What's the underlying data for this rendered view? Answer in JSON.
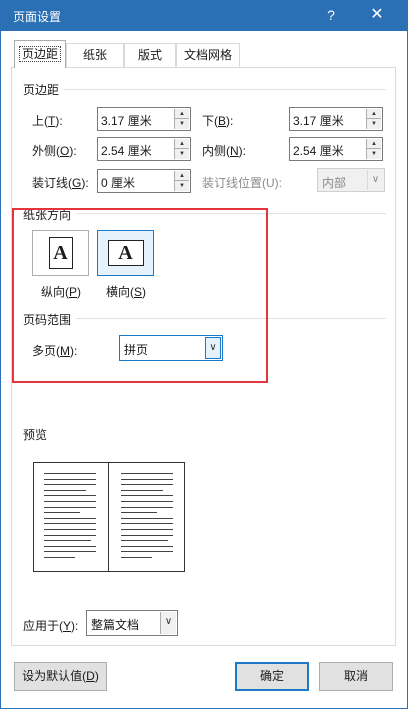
{
  "titlebar": {
    "title": "页面设置",
    "help": "?",
    "close": "✕"
  },
  "tabs": [
    "页边距",
    "纸张",
    "版式",
    "文档网格"
  ],
  "margins": {
    "group_label": "页边距",
    "top": {
      "label_pre": "上(",
      "key": "T",
      "label_post": "):",
      "value": "3.17 厘米"
    },
    "bottom": {
      "label_pre": "下(",
      "key": "B",
      "label_post": "):",
      "value": "3.17 厘米"
    },
    "outside": {
      "label_pre": "外侧(",
      "key": "O",
      "label_post": "):",
      "value": "2.54 厘米"
    },
    "inside": {
      "label_pre": "内侧(",
      "key": "N",
      "label_post": "):",
      "value": "2.54 厘米"
    },
    "gutter": {
      "label_pre": "装订线(",
      "key": "G",
      "label_post": "):",
      "value": "0 厘米"
    },
    "gutter_position": {
      "label": "装订线位置(U):",
      "value": "内部"
    }
  },
  "orientation": {
    "group_label": "纸张方向",
    "portrait": {
      "glyph": "A",
      "label_pre": "纵向(",
      "key": "P",
      "label_post": ")"
    },
    "landscape": {
      "glyph": "A",
      "label_pre": "横向(",
      "key": "S",
      "label_post": ")"
    }
  },
  "pages": {
    "group_label": "页码范围",
    "multiple": {
      "label_pre": "多页(",
      "key": "M",
      "label_post": "):",
      "value": "拼页"
    }
  },
  "preview": {
    "group_label": "预览",
    "apply_to": {
      "label_pre": "应用于(",
      "key": "Y",
      "label_post": "):",
      "value": "整篇文档"
    }
  },
  "buttons": {
    "set_default": {
      "label_pre": "设为默认值(",
      "key": "D",
      "label_post": ")"
    },
    "ok": "确定",
    "cancel": "取消"
  },
  "colors": {
    "titlebar": "#2b6fb4",
    "highlight_border": "#e5343d",
    "focus": "#1e78c8"
  }
}
